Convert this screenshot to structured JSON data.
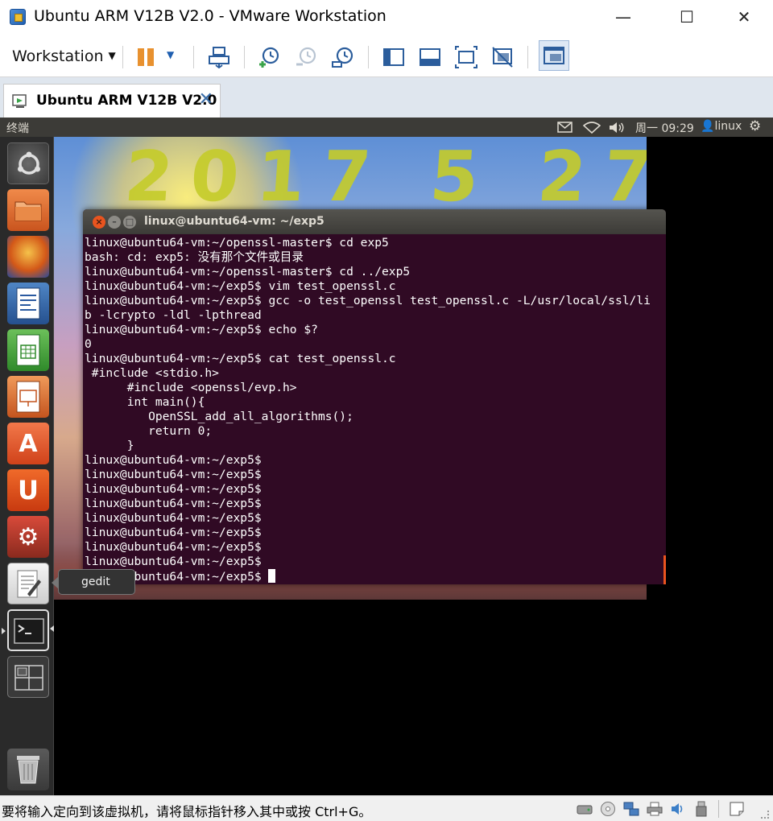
{
  "window": {
    "title": "Ubuntu ARM V12B V2.0 - VMware Workstation",
    "minimize": "—",
    "maximize": "☐",
    "close": "✕"
  },
  "toolbar": {
    "menu_label": "Workstation",
    "menu_caret": "▼",
    "pause_caret": "▼"
  },
  "tab": {
    "label": "Ubuntu ARM V12B V2.0",
    "close": "✕"
  },
  "ubuntu_panel": {
    "title": "终端",
    "datetime": "周一 09:29",
    "user": "linux"
  },
  "wallpaper": {
    "handwriting": "2017 5 27"
  },
  "launcher": {
    "tooltip": "gedit"
  },
  "terminal": {
    "title": "linux@ubuntu64-vm: ~/exp5",
    "lines": [
      "linux@ubuntu64-vm:~/openssl-master$ cd exp5",
      "bash: cd: exp5: 没有那个文件或目录",
      "linux@ubuntu64-vm:~/openssl-master$ cd ../exp5",
      "linux@ubuntu64-vm:~/exp5$ vim test_openssl.c",
      "linux@ubuntu64-vm:~/exp5$ gcc -o test_openssl test_openssl.c -L/usr/local/ssl/li",
      "b -lcrypto -ldl -lpthread",
      "linux@ubuntu64-vm:~/exp5$ echo $?",
      "0",
      "linux@ubuntu64-vm:~/exp5$ cat test_openssl.c",
      " #include <stdio.h>",
      "      #include <openssl/evp.h>",
      "      int main(){",
      "         OpenSSL_add_all_algorithms();",
      "         return 0;",
      "      }",
      "linux@ubuntu64-vm:~/exp5$",
      "linux@ubuntu64-vm:~/exp5$",
      "linux@ubuntu64-vm:~/exp5$",
      "linux@ubuntu64-vm:~/exp5$",
      "linux@ubuntu64-vm:~/exp5$",
      "linux@ubuntu64-vm:~/exp5$",
      "linux@ubuntu64-vm:~/exp5$",
      "linux@ubuntu64-vm:~/exp5$"
    ],
    "prompt": "linux@ubuntu64-vm:~/exp5$ "
  },
  "statusbar": {
    "message": "要将输入定向到该虚拟机，请将鼠标指针移入其中或按 Ctrl+G。"
  },
  "colors": {
    "terminal_bg": "#300a24",
    "ubuntu_panel": "#3c3b37",
    "launcher_bg": "#2a2a2a",
    "pause_orange": "#e8912f"
  }
}
